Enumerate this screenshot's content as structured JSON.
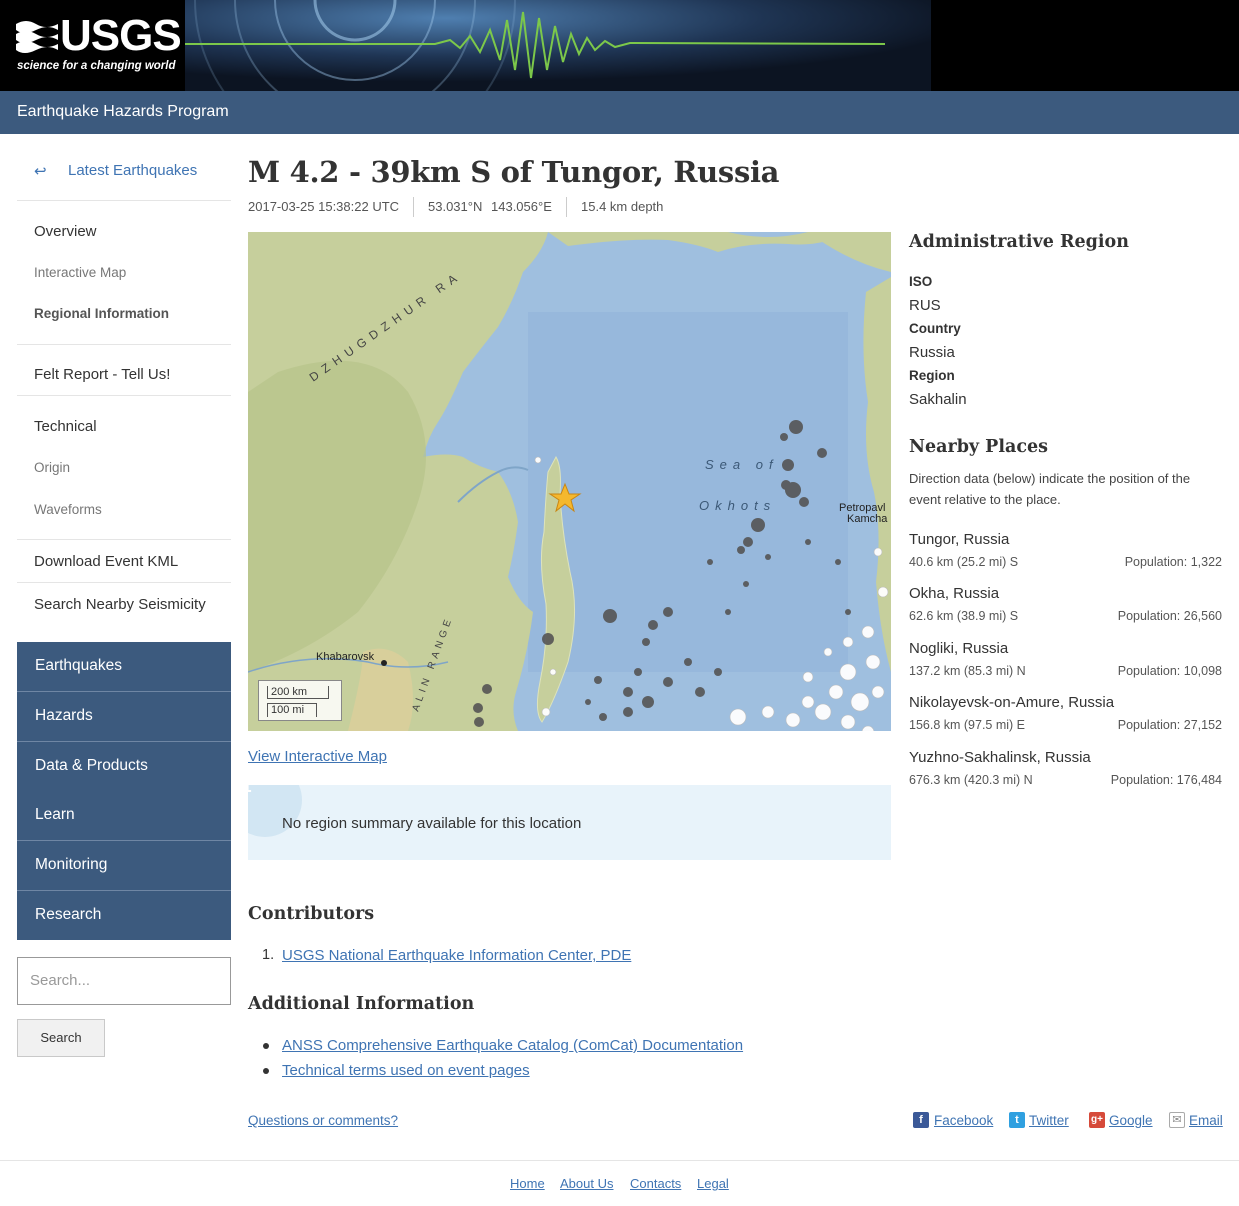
{
  "header": {
    "logo_text": "USGS",
    "logo_tagline": "science for a changing world",
    "program": "Earthquake Hazards Program"
  },
  "sidebar": {
    "back_label": "Latest Earthquakes",
    "items": {
      "overview": "Overview",
      "interactive_map": "Interactive Map",
      "regional_information": "Regional Information",
      "felt_report": "Felt Report - Tell Us!",
      "technical": "Technical",
      "origin": "Origin",
      "waveforms": "Waveforms",
      "download_kml": "Download Event KML",
      "search_seismicity": "Search Nearby Seismicity"
    },
    "nav": [
      "Earthquakes",
      "Hazards",
      "Data & Products",
      "Learn",
      "Monitoring",
      "Research"
    ],
    "search_placeholder": "Search...",
    "search_button": "Search"
  },
  "event": {
    "title": "M 4.2 - 39km S of Tungor, Russia",
    "time": "2017-03-25 15:38:22 UTC",
    "lat": "53.031°N",
    "lon": "143.056°E",
    "depth": "15.4 km depth"
  },
  "map": {
    "labels": {
      "range1": "DZHUGDZHUR RA",
      "sea1": "Sea of",
      "sea2": "Okhots",
      "city_khabarovsk": "Khabarovsk",
      "city_petropavl": "Petropavl",
      "city_kamcha": "Kamcha",
      "range2": "ALIN RANGE"
    },
    "scale_km": "200 km",
    "scale_mi": "100 mi",
    "link": "View Interactive Map",
    "colors": {
      "sea": "#9fbfdf",
      "land": "#c6cf9c",
      "star": "#f5b82e"
    }
  },
  "notice": "No region summary available for this location",
  "contributors": {
    "heading": "Contributors",
    "items": [
      "USGS National Earthquake Information Center, PDE"
    ]
  },
  "additional": {
    "heading": "Additional Information",
    "items": [
      "ANSS Comprehensive Earthquake Catalog (ComCat) Documentation",
      "Technical terms used on event pages"
    ]
  },
  "feedback": "Questions or comments?",
  "share": {
    "facebook": "Facebook",
    "twitter": "Twitter",
    "google": "Google",
    "email": "Email"
  },
  "footer": [
    "Home",
    "About Us",
    "Contacts",
    "Legal"
  ],
  "admin": {
    "heading": "Administrative Region",
    "iso_label": "ISO",
    "iso": "RUS",
    "country_label": "Country",
    "country": "Russia",
    "region_label": "Region",
    "region": "Sakhalin"
  },
  "nearby": {
    "heading": "Nearby Places",
    "note": "Direction data (below) indicate the position of the event relative to the place.",
    "places": [
      {
        "name": "Tungor, Russia",
        "dist": "40.6 km (25.2 mi) S",
        "pop": "Population: 1,322"
      },
      {
        "name": "Okha, Russia",
        "dist": "62.6 km (38.9 mi) S",
        "pop": "Population: 26,560"
      },
      {
        "name": "Nogliki, Russia",
        "dist": "137.2 km (85.3 mi) N",
        "pop": "Population: 10,098"
      },
      {
        "name": "Nikolayevsk-on-Amure, Russia",
        "dist": "156.8 km (97.5 mi) E",
        "pop": "Population: 27,152"
      },
      {
        "name": "Yuzhno-Sakhalinsk, Russia",
        "dist": "676.3 km (420.3 mi) N",
        "pop": "Population: 176,484"
      }
    ]
  }
}
